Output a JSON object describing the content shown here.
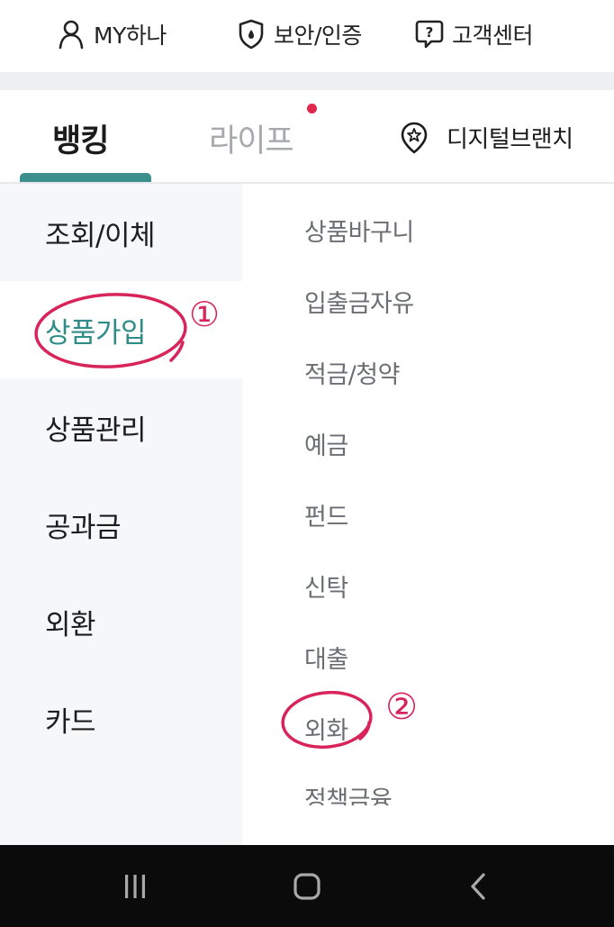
{
  "top_bar": {
    "items": [
      {
        "label": "MY하나",
        "icon": "person-icon"
      },
      {
        "label": "보안/인증",
        "icon": "shield-icon"
      },
      {
        "label": "고객센터",
        "icon": "help-chat-icon"
      }
    ]
  },
  "main_tabs": {
    "items": [
      {
        "label": "뱅킹",
        "active": true
      },
      {
        "label": "라이프",
        "active": false,
        "has_notification_dot": true
      }
    ],
    "digital_branch": {
      "label": "디지털브랜치",
      "icon": "location-star-icon"
    }
  },
  "categories": {
    "items": [
      {
        "label": "조회/이체",
        "active": false
      },
      {
        "label": "상품가입",
        "active": true
      },
      {
        "label": "상품관리",
        "active": false
      },
      {
        "label": "공과금",
        "active": false
      },
      {
        "label": "외환",
        "active": false
      },
      {
        "label": "카드",
        "active": false
      }
    ]
  },
  "submenu": {
    "items": [
      "상품바구니",
      "입출금자유",
      "적금/청약",
      "예금",
      "펀드",
      "신탁",
      "대출",
      "외화",
      "정책금융"
    ]
  },
  "annotations": {
    "mark_1": "①",
    "mark_2": "②"
  },
  "system_nav": {
    "buttons": [
      "recent-apps-icon",
      "home-icon",
      "back-icon"
    ]
  },
  "colors": {
    "accent": "#2f8c88",
    "tab_indicator": "#3c8f8c",
    "notification_dot": "#e0284f",
    "annotation": "#d8245a",
    "left_panel_bg": "#f6f7f9",
    "nav_bar": "#0b0b0b"
  }
}
